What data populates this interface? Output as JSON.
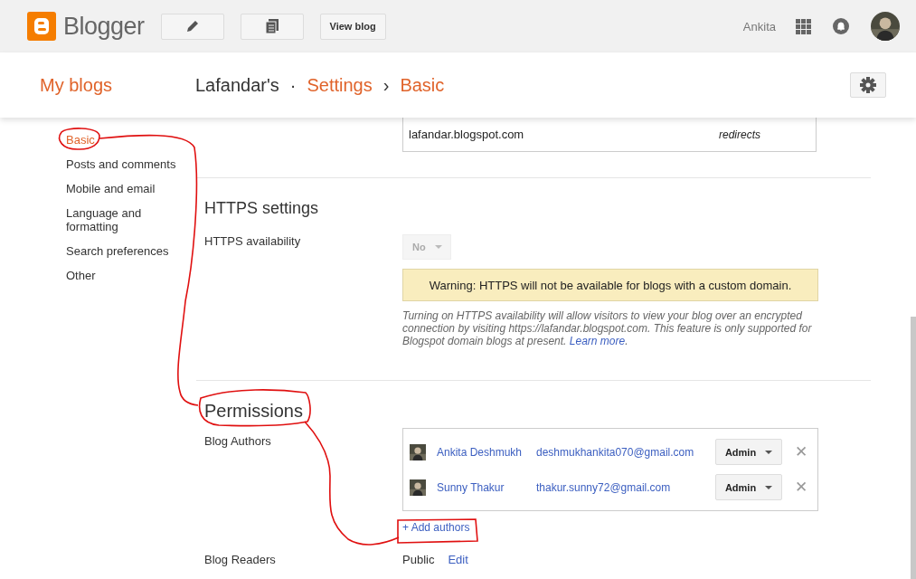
{
  "top_bar": {
    "logo_text": "Blogger",
    "view_blog_button": "View blog",
    "user_name": "Ankita"
  },
  "breadcrumb": {
    "my_blogs": "My blogs",
    "blog": "Lafandar's",
    "separator": "·",
    "section": "Settings",
    "arrow": "›",
    "page": "Basic"
  },
  "sidebar": {
    "items": [
      {
        "label": "Basic",
        "selected": true
      },
      {
        "label": "Posts and comments",
        "selected": false
      },
      {
        "label": "Mobile and email",
        "selected": false
      },
      {
        "label": "Language and formatting",
        "selected": false
      },
      {
        "label": "Search preferences",
        "selected": false
      },
      {
        "label": "Other",
        "selected": false
      }
    ]
  },
  "blog_address": {
    "domain": "lafandar.blogspot.com",
    "status": "redirects"
  },
  "https_settings": {
    "title": "HTTPS settings",
    "label": "HTTPS availability",
    "dropdown": {
      "value": "No",
      "disabled": true
    },
    "warning": "Warning: HTTPS will not be available for blogs with a custom domain.",
    "note": "Turning on HTTPS availability will allow visitors to view your blog over an encrypted connection by visiting https://lafandar.blogspot.com. This feature is only supported for Blogspot domain blogs at present.",
    "note_link": "Learn more",
    "note_end": "."
  },
  "permissions": {
    "title": "Permissions",
    "authors_label": "Blog Authors",
    "authors": [
      {
        "name": "Ankita Deshmukh",
        "email": "deshmukhankita070@gmail.com",
        "role": "Admin",
        "remove": "✕"
      },
      {
        "name": "Sunny Thakur",
        "email": "thakur.sunny72@gmail.com",
        "role": "Admin",
        "remove": "✕"
      }
    ],
    "add_authors": "+ Add authors",
    "readers_label": "Blog Readers",
    "readers_value": "Public",
    "readers_edit": "Edit"
  }
}
